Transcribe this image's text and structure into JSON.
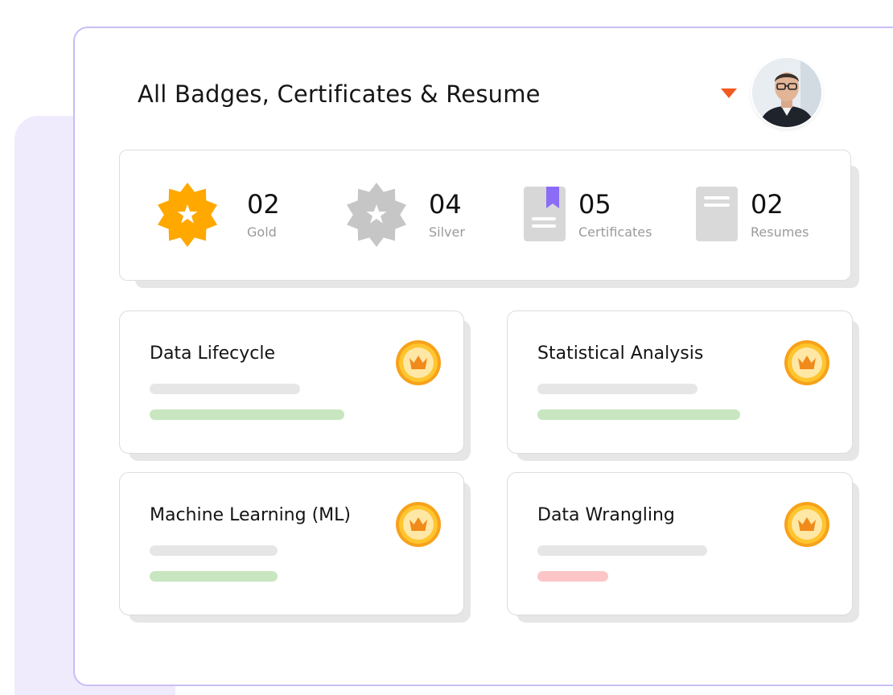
{
  "header": {
    "title": "All Badges, Certificates & Resume",
    "dropdown_icon": "caret-down-icon",
    "avatar_icon": "user-avatar"
  },
  "stats": [
    {
      "key": "gold",
      "value": "02",
      "label": "Gold",
      "icon": "gold-badge-icon",
      "color": "#ffa800"
    },
    {
      "key": "silver",
      "value": "04",
      "label": "Silver",
      "icon": "silver-badge-icon",
      "color": "#c6c6c6"
    },
    {
      "key": "certificates",
      "value": "05",
      "label": "Certificates",
      "icon": "certificate-icon",
      "color": "#8b6cf6"
    },
    {
      "key": "resumes",
      "value": "02",
      "label": "Resumes",
      "icon": "resume-icon",
      "color": "#d6d6d6"
    }
  ],
  "courses": [
    {
      "title": "Data Lifecycle",
      "medal_icon": "crown-medal-icon",
      "progress_status": "green"
    },
    {
      "title": "Statistical Analysis",
      "medal_icon": "crown-medal-icon",
      "progress_status": "green"
    },
    {
      "title": "Machine Learning (ML)",
      "medal_icon": "crown-medal-icon",
      "progress_status": "green"
    },
    {
      "title": "Data Wrangling",
      "medal_icon": "crown-medal-icon",
      "progress_status": "red"
    }
  ],
  "colors": {
    "accent": "#f15a22",
    "border_purple": "#c9bdf5",
    "background_lavender": "#efebfd",
    "progress_green": "#c8e6bf",
    "progress_red": "#fcc6c6",
    "medal_gold": "#ffb300"
  }
}
